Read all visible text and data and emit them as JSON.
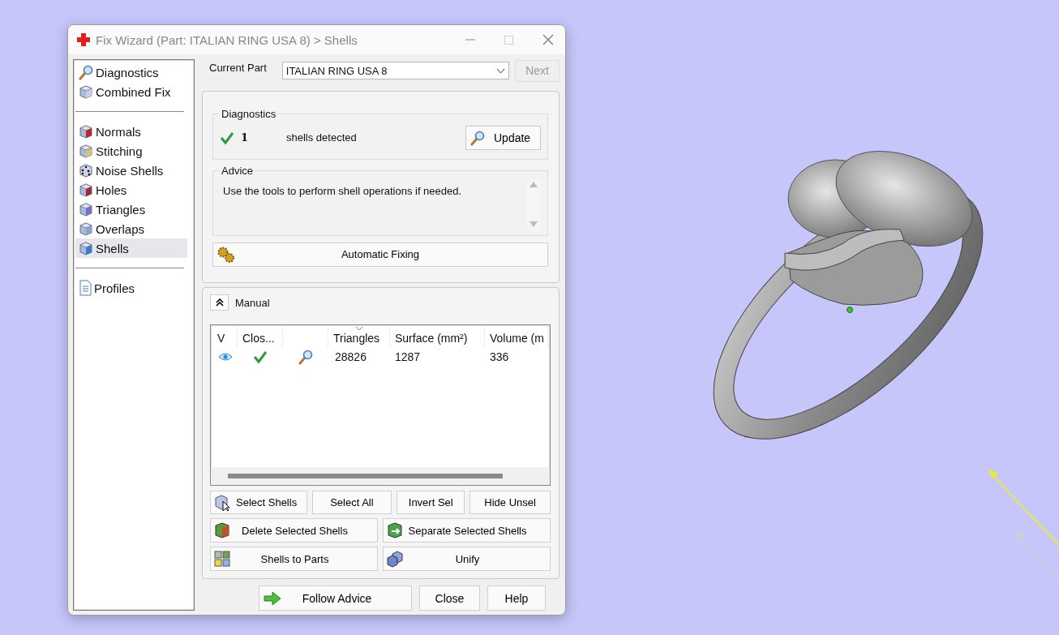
{
  "window": {
    "title": "Fix Wizard (Part: ITALIAN RING USA 8) > Shells"
  },
  "sidebar": {
    "sections": [
      {
        "items": [
          {
            "label": "Diagnostics",
            "selected": false
          },
          {
            "label": "Combined Fix",
            "selected": false
          }
        ]
      },
      {
        "items": [
          {
            "label": "Normals",
            "selected": false
          },
          {
            "label": "Stitching",
            "selected": false
          },
          {
            "label": "Noise Shells",
            "selected": false
          },
          {
            "label": "Holes",
            "selected": false
          },
          {
            "label": "Triangles",
            "selected": false
          },
          {
            "label": "Overlaps",
            "selected": false
          },
          {
            "label": "Shells",
            "selected": true
          }
        ]
      },
      {
        "items": [
          {
            "label": "Profiles",
            "selected": false
          }
        ]
      }
    ]
  },
  "current_part": {
    "label": "Current Part",
    "value": "ITALIAN RING USA 8",
    "next_button": {
      "label": "Next",
      "disabled": true
    }
  },
  "diagnostics": {
    "title": "Diagnostics",
    "ok": true,
    "count": "1",
    "text": "shells detected",
    "update_button": "Update"
  },
  "advice": {
    "title": "Advice",
    "text": "Use the tools to perform shell operations if needed."
  },
  "automatic_fixing_button": "Automatic Fixing",
  "manual": {
    "title": "Manual",
    "expanded": true
  },
  "table": {
    "columns": [
      "V",
      "Clos...",
      "",
      "Triangles",
      "Surface (mm²)",
      "Volume (m"
    ],
    "rows": [
      {
        "visible": true,
        "closed": true,
        "triangles": "28826",
        "surface": "1287",
        "volume": "336"
      }
    ]
  },
  "tool_buttons": [
    [
      "Select Shells",
      "Select All",
      "Invert Sel",
      "Hide Unsel"
    ],
    [
      "Delete Selected Shells",
      "Separate Selected Shells"
    ],
    [
      "Shells to Parts",
      "Unify"
    ]
  ],
  "footer_buttons": [
    "Follow Advice",
    "Close",
    "Help"
  ]
}
